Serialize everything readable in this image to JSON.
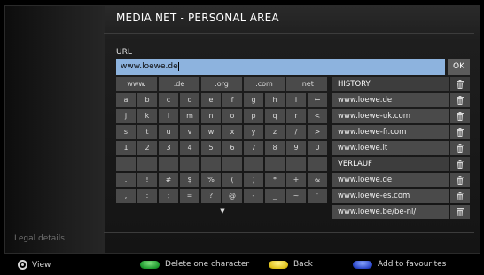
{
  "header": {
    "title": "MEDIA NET - PERSONAL AREA"
  },
  "sidebar": {
    "legal": "Legal details"
  },
  "url": {
    "label": "URL",
    "value": "www.loewe.de",
    "ok_label": "OK"
  },
  "keyboard": {
    "top_row": [
      "www.",
      ".de",
      ".org",
      ".com",
      ".net"
    ],
    "rows": [
      [
        "a",
        "b",
        "c",
        "d",
        "e",
        "f",
        "g",
        "h",
        "i",
        "←"
      ],
      [
        "j",
        "k",
        "l",
        "m",
        "n",
        "o",
        "p",
        "q",
        "r",
        "<"
      ],
      [
        "s",
        "t",
        "u",
        "v",
        "w",
        "x",
        "y",
        "z",
        "/",
        ">"
      ],
      [
        "1",
        "2",
        "3",
        "4",
        "5",
        "6",
        "7",
        "8",
        "9",
        "0"
      ],
      [
        "",
        "",
        "",
        "",
        "",
        "",
        "",
        "",
        "",
        ""
      ],
      [
        ".",
        "!",
        "#",
        "$",
        "%",
        "(",
        ")",
        "*",
        "+",
        "&"
      ],
      [
        ",",
        ":",
        ";",
        "=",
        "?",
        "@",
        "-",
        "_",
        "~",
        "'"
      ]
    ],
    "more_glyph": "▼"
  },
  "history": {
    "rows": [
      {
        "text": "HISTORY",
        "header": true
      },
      {
        "text": "www.loewe.de",
        "header": false
      },
      {
        "text": "www.loewe-uk.com",
        "header": false
      },
      {
        "text": "www.loewe-fr.com",
        "header": false
      },
      {
        "text": "www.loewe.it",
        "header": false
      },
      {
        "text": "VERLAUF",
        "header": true
      },
      {
        "text": "www.loewe.de",
        "header": false
      },
      {
        "text": "www.loewe-es.com",
        "header": false
      },
      {
        "text": "www.loewe.be/be-nl/",
        "header": false
      }
    ]
  },
  "footer": {
    "view": "View",
    "delete": "Delete one character",
    "back": "Back",
    "favourites": "Add to favourites"
  },
  "colors": {
    "input_bg": "#8db3de",
    "key_bg": "#4a4a4a",
    "green": "#1e9a2e",
    "yellow": "#e0c21a",
    "blue": "#2a46c8"
  },
  "icons": {
    "delete": "trash-icon",
    "nav": "navigation-ring-icon"
  }
}
